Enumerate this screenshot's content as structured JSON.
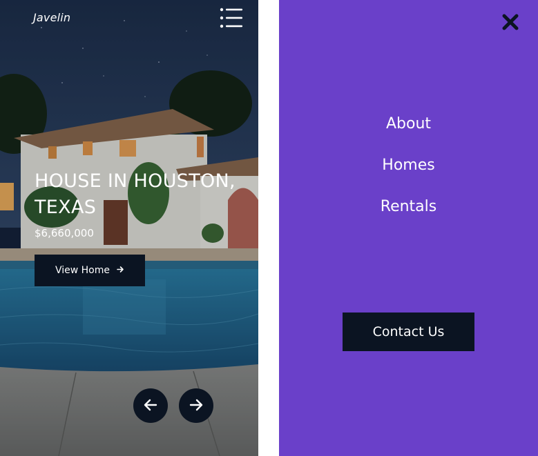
{
  "header": {
    "brand": "Javelin",
    "menu_icon": "list-menu-icon"
  },
  "listing": {
    "title": "HOUSE IN HOUSTON, TEXAS",
    "price": "$6,660,000",
    "cta_label": "View Home",
    "cta_icon": "arrow-right-icon"
  },
  "carousel": {
    "prev_icon": "arrow-left-icon",
    "next_icon": "arrow-right-icon"
  },
  "menu": {
    "close_icon": "close-icon",
    "items": [
      {
        "label": "About"
      },
      {
        "label": "Homes"
      },
      {
        "label": "Rentals"
      }
    ],
    "contact_label": "Contact Us"
  },
  "colors": {
    "menu_background": "#6a40c9",
    "button_dark": "#0b1422",
    "text": "#ffffff"
  }
}
